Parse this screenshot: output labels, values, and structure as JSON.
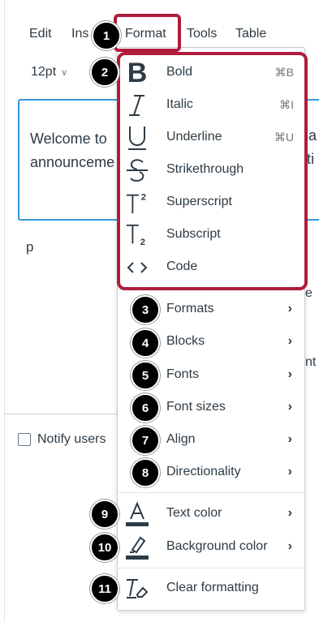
{
  "menubar": {
    "edit": "Edit",
    "insert_partial": "Ins",
    "format": "Format",
    "tools": "Tools",
    "table": "Table"
  },
  "toolbar": {
    "font_size": "12pt"
  },
  "editor": {
    "line1": "Welcome to",
    "line2": "announceme",
    "right1": "a",
    "right2": "ti"
  },
  "paragraph_tag": "p",
  "notify": {
    "label": "Notify users"
  },
  "right_fragments": [
    "e",
    "nt"
  ],
  "format_menu": {
    "items": [
      {
        "label": "Bold",
        "shortcut": "⌘B",
        "icon": "bold-icon"
      },
      {
        "label": "Italic",
        "shortcut": "⌘I",
        "icon": "italic-icon"
      },
      {
        "label": "Underline",
        "shortcut": "⌘U",
        "icon": "underline-icon"
      },
      {
        "label": "Strikethrough",
        "icon": "strikethrough-icon"
      },
      {
        "label": "Superscript",
        "icon": "superscript-icon"
      },
      {
        "label": "Subscript",
        "icon": "subscript-icon"
      },
      {
        "label": "Code",
        "icon": "code-icon"
      },
      {
        "label": "Formats"
      },
      {
        "label": "Blocks"
      },
      {
        "label": "Fonts"
      },
      {
        "label": "Font sizes"
      },
      {
        "label": "Align"
      },
      {
        "label": "Directionality"
      },
      {
        "label": "Text color",
        "icon": "text-color-icon"
      },
      {
        "label": "Background color",
        "icon": "background-color-icon"
      },
      {
        "label": "Clear formatting",
        "icon": "clear-formatting-icon"
      }
    ]
  },
  "badges": [
    "1",
    "2",
    "3",
    "4",
    "5",
    "6",
    "7",
    "8",
    "9",
    "10",
    "11"
  ],
  "colors": {
    "highlight": "#b01c3c",
    "editor_border": "#3498db",
    "text": "#2d3b45"
  }
}
